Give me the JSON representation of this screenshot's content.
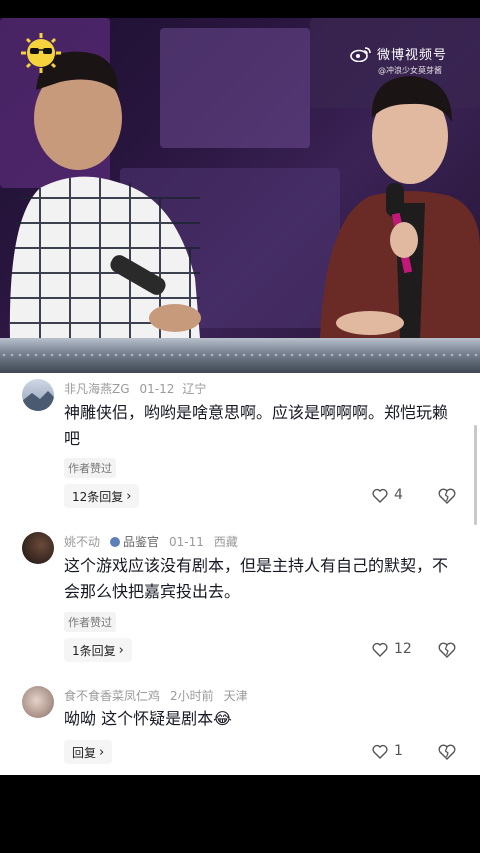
{
  "video": {
    "watermark": "微博视频号",
    "watermark_sub": "@冲浪少女莫芽酱",
    "sticker_icon": "sunglasses-sun-sticker"
  },
  "comments": [
    {
      "username": "非凡海燕ZG",
      "date": "01-12",
      "location": "辽宁",
      "text": "神雕侠侣，哟哟是啥意思啊。应该是啊啊啊。郑恺玩赖吧",
      "liked_label": "作者赞过",
      "reply_label": "12条回复",
      "like_count": "4"
    },
    {
      "username": "姚不动",
      "badge": "品鉴官",
      "date": "01-11",
      "location": "西藏",
      "text": "这个游戏应该没有剧本，但是主持人有自己的默契，不会那么快把嘉宾投出去。",
      "liked_label": "作者赞过",
      "reply_label": "1条回复",
      "like_count": "12"
    },
    {
      "username": "食不食香菜凤仁鸡",
      "date": "2小时前",
      "location": "天津",
      "text": "呦呦 这个怀疑是剧本😂",
      "reply_label": "回复",
      "like_count": "1"
    }
  ],
  "colors": {
    "accent": "#161823",
    "meta": "#9a9a9a"
  }
}
